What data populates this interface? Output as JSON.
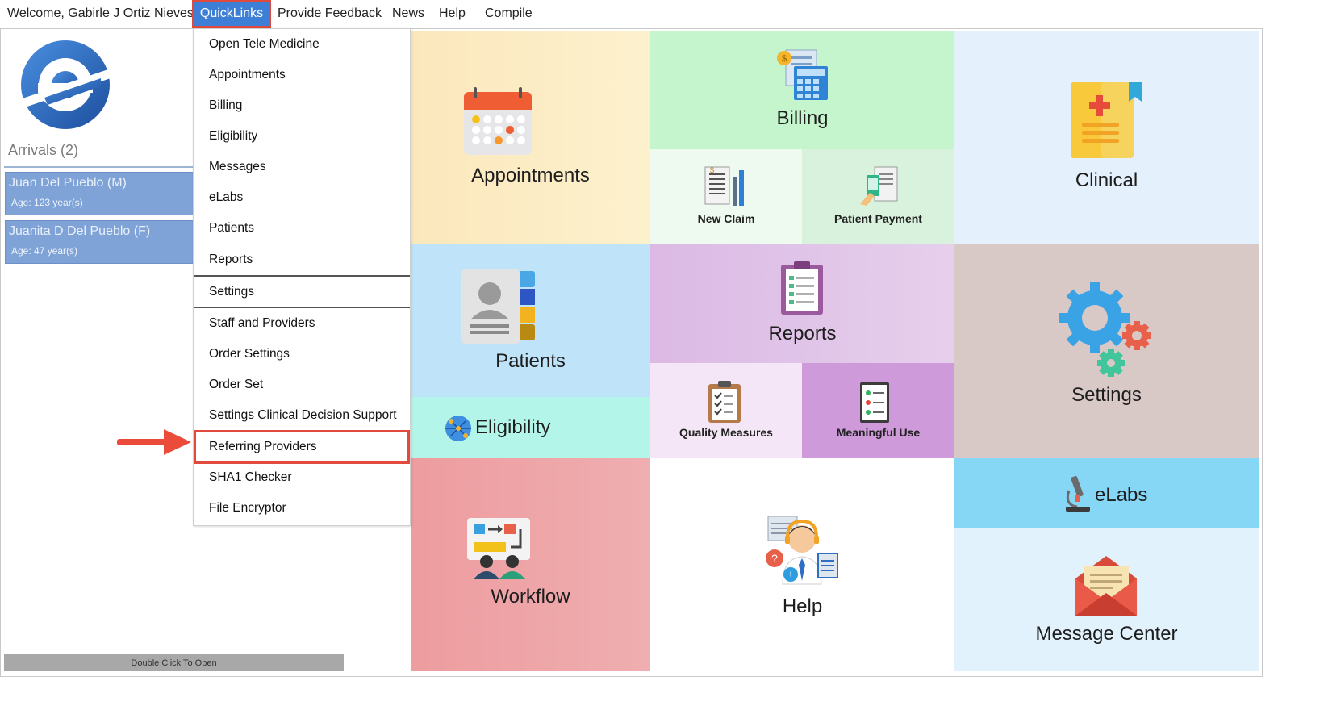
{
  "menubar": {
    "welcome": "Welcome, Gabirle J Ortiz Nieves",
    "quicklinks": "QuickLinks",
    "feedback": "Provide Feedback",
    "news": "News",
    "help": "Help",
    "compile": "Compile"
  },
  "arrivals": {
    "title": "Arrivals (2)",
    "patients": [
      {
        "name": "Juan Del Pueblo (M)",
        "age": "Age: 123 year(s)"
      },
      {
        "name": "Juanita D Del Pueblo (F)",
        "age": "Age: 47 year(s)"
      }
    ],
    "footer": "Double Click To Open"
  },
  "quicklinks_menu": {
    "items": [
      "Open Tele Medicine",
      "Appointments",
      "Billing",
      "Eligibility",
      "Messages",
      "eLabs",
      "Patients",
      "Reports",
      "Settings",
      "Staff and Providers",
      "Order Settings",
      "Order Set",
      "Settings Clinical Decision Support",
      "Referring Providers",
      "SHA1 Checker",
      "File Encryptor"
    ],
    "highlighted": "Referring Providers"
  },
  "tiles": {
    "appointments": "Appointments",
    "billing": "Billing",
    "new_claim": "New Claim",
    "patient_payment": "Patient Payment",
    "clinical": "Clinical",
    "patients": "Patients",
    "eligibility": "Eligibility",
    "reports": "Reports",
    "quality_measures": "Quality Measures",
    "meaningful_use": "Meaningful Use",
    "settings": "Settings",
    "workflow": "Workflow",
    "help": "Help",
    "elabs": "eLabs",
    "message_center": "Message Center"
  },
  "colors": {
    "menu_active": "#3d7fd6",
    "highlight_red": "#e14a3c",
    "appointments_bg": "#fcecc0",
    "billing_bg": "#c6f5cf",
    "clinical_bg": "#e4f0fb",
    "patients_bg": "#bfe4f9",
    "eligibility_bg": "#b5f5ea",
    "reports_bg": "#e3c8e9",
    "meaningful_use_bg": "#cf9bd9",
    "settings_bg": "#d8cac7",
    "elabs_bg": "#86d6f6",
    "message_center_bg": "#e2f2fc",
    "workflow_bg": "#eda4a8"
  }
}
